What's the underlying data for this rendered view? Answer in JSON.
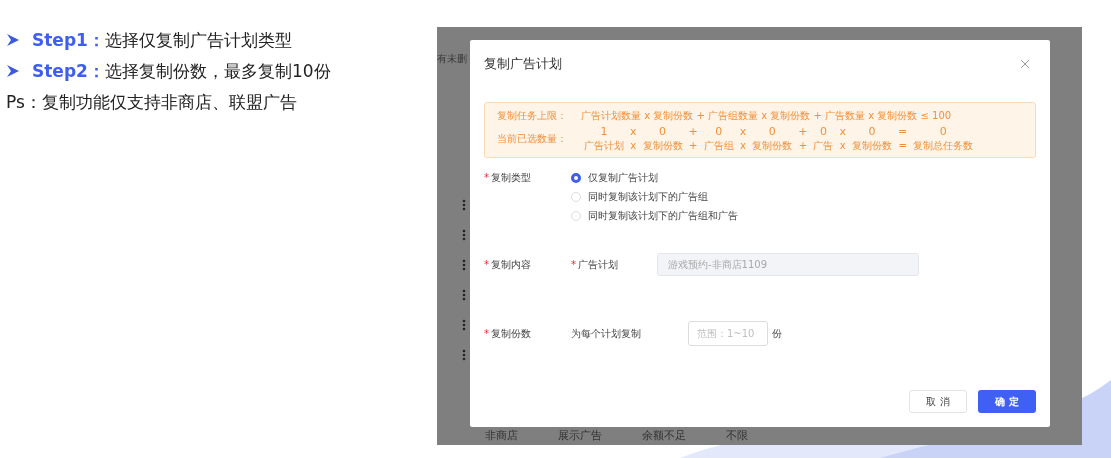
{
  "notes": [
    {
      "kind": "step",
      "label": "Step1：",
      "text": "选择仅复制广告计划类型"
    },
    {
      "kind": "step",
      "label": "Step2：",
      "text": "选择复制份数，最多复制10份"
    },
    {
      "kind": "plain",
      "label": "Ps：",
      "text": "复制功能仅支持非商店、联盟广告"
    }
  ],
  "background_page": {
    "filter_text": "有未删",
    "last_row": [
      "非商店",
      "展示广告",
      "余额不足",
      "不限"
    ]
  },
  "dialog": {
    "title": "复制广告计划",
    "required_mark": "*",
    "limit": {
      "label": "复制任务上限：",
      "formula": "广告计划数量 x 复制份数 + 广告组数量 x 复制份数 + 广告数量 x 复制份数 ≤ 100"
    },
    "current": {
      "label": "当前已选数量：",
      "terms": [
        {
          "value": "1",
          "caption": "广告计划"
        },
        {
          "value": "x",
          "caption": "x"
        },
        {
          "value": "0",
          "caption": "复制份数"
        },
        {
          "value": "+",
          "caption": "+"
        },
        {
          "value": "0",
          "caption": "广告组"
        },
        {
          "value": "x",
          "caption": "x"
        },
        {
          "value": "0",
          "caption": "复制份数"
        },
        {
          "value": "+",
          "caption": "+"
        },
        {
          "value": "0",
          "caption": "广告"
        },
        {
          "value": "x",
          "caption": "x"
        },
        {
          "value": "0",
          "caption": "复制份数"
        },
        {
          "value": "=",
          "caption": "="
        },
        {
          "value": "0",
          "caption": "复制总任务数"
        }
      ]
    },
    "copy_type": {
      "label": "复制类型",
      "required": true,
      "options": [
        {
          "label": "仅复制广告计划",
          "selected": true
        },
        {
          "label": "同时复制该计划下的广告组",
          "selected": false
        },
        {
          "label": "同时复制该计划下的广告组和广告",
          "selected": false
        }
      ]
    },
    "copy_content": {
      "label": "复制内容",
      "required": true,
      "sub_label": "广告计划",
      "sub_required": true,
      "value": "游戏预约-非商店1109",
      "disabled": true
    },
    "copy_count": {
      "label": "复制份数",
      "required": true,
      "prefix": "为每个计划复制",
      "placeholder": "范围：1~10",
      "suffix": "份"
    },
    "buttons": [
      {
        "label": "取 消",
        "kind": "secondary"
      },
      {
        "label": "确 定",
        "kind": "primary"
      }
    ]
  }
}
